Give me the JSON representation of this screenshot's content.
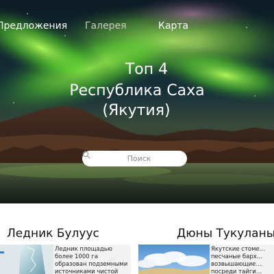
{
  "nav": {
    "offers": "Предложения",
    "gallery": "Галерея",
    "map": "Карта"
  },
  "hero": {
    "line1": "Топ 4",
    "line2": "Республика Саха",
    "line3": "(Якутия)"
  },
  "search": {
    "placeholder": "Поиск"
  },
  "cards": [
    {
      "title": "Ледник Булуус",
      "text": "Ледник площадью более 1000 га образован подземными источниками чистой"
    },
    {
      "title": "Дюны Тукуланы",
      "text": "Якутские стоме… песчаные барх… возвышающие… посреди тайги…"
    }
  ],
  "colors": {
    "aurora": "#7dff3a",
    "sky": "#0b1a22",
    "nav_muted": "#c9cdbf"
  }
}
